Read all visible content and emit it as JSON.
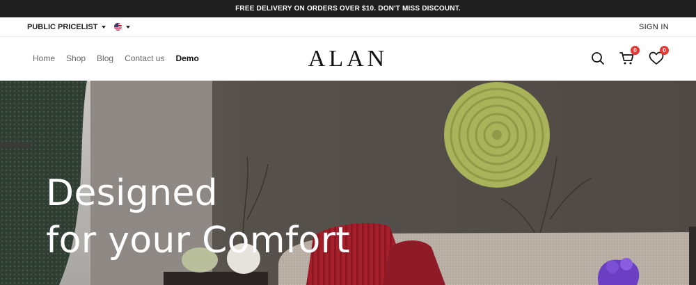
{
  "announcement": "FREE DELIVERY ON ORDERS OVER $10. DON'T MISS DISCOUNT.",
  "topbar": {
    "pricelist": "PUBLIC PRICELIST",
    "language_icon": "us-flag-icon",
    "signin": "SIGN IN"
  },
  "nav": {
    "items": [
      {
        "label": "Home"
      },
      {
        "label": "Shop"
      },
      {
        "label": "Blog"
      },
      {
        "label": "Contact us"
      },
      {
        "label": "Demo"
      }
    ]
  },
  "logo": "ALAN",
  "header_icons": {
    "search": "search-icon",
    "cart": "cart-icon",
    "cart_count": "0",
    "wishlist": "heart-icon",
    "wishlist_count": "0",
    "badge_color": "#e53935"
  },
  "hero": {
    "line1": "Designed",
    "line2": "for your Comfort"
  }
}
